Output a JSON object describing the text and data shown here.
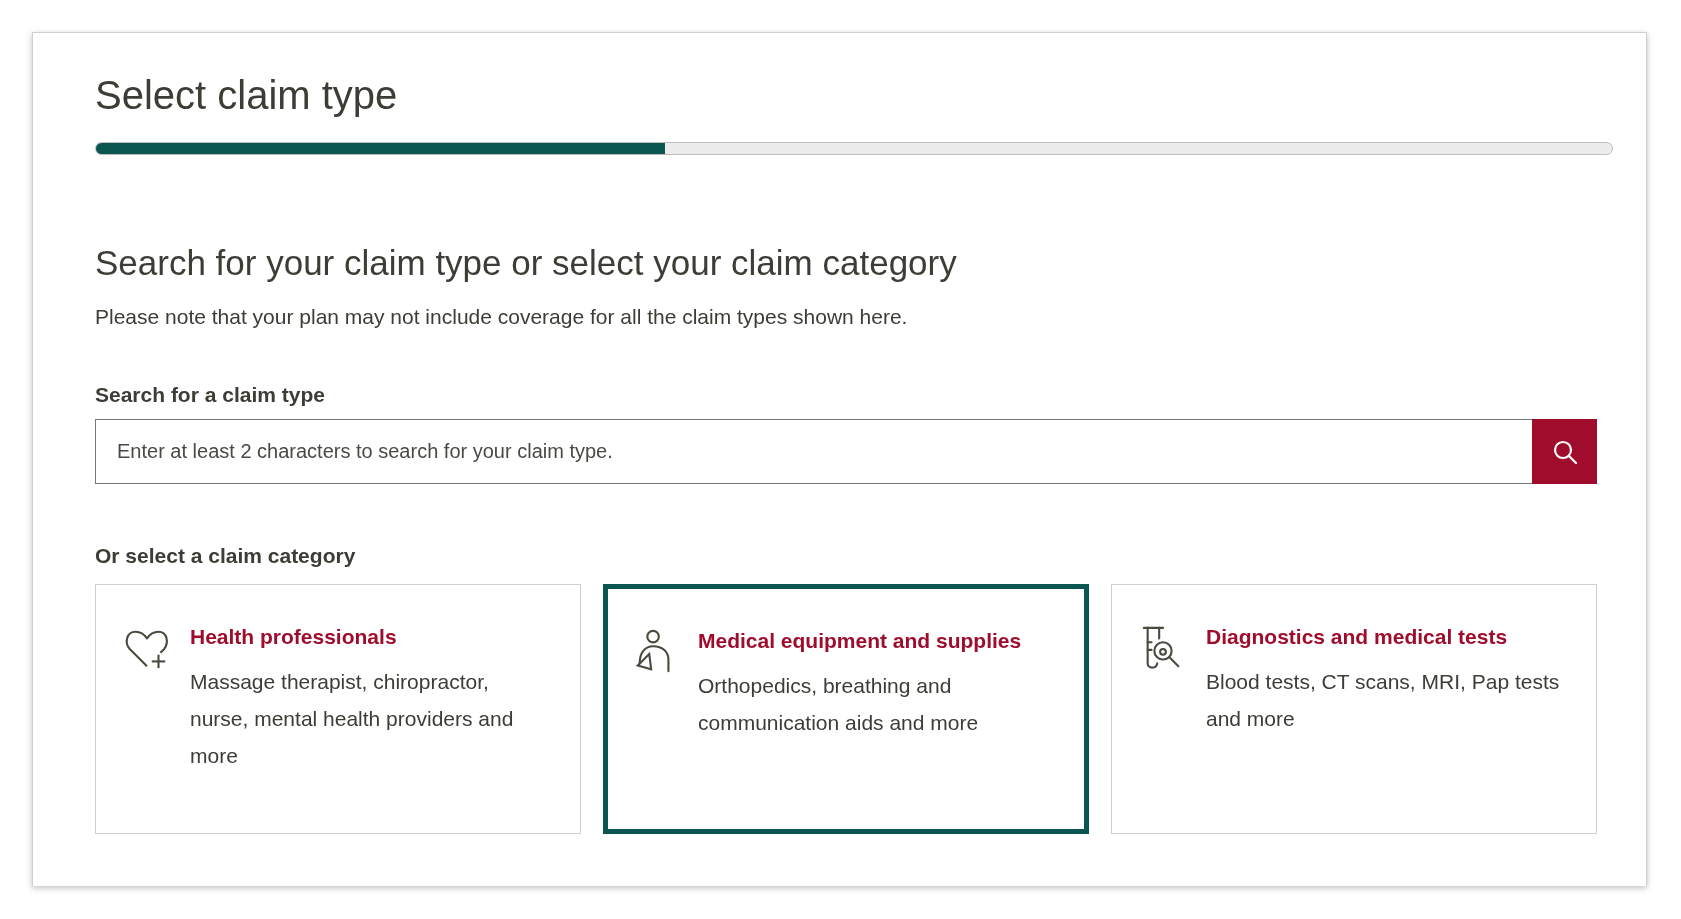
{
  "page_title": "Select claim type",
  "progress": {
    "level": 0.375
  },
  "heading": "Search for your claim type or select your claim category",
  "note": "Please note that your plan may not include coverage for all the claim types shown here.",
  "search": {
    "label": "Search for a claim type",
    "placeholder": "Enter at least 2 characters to search for your claim type."
  },
  "categories_label": "Or select a claim category",
  "categories": [
    {
      "kind": "heart",
      "title": "Health professionals",
      "description": "Massage therapist, chiropractor, nurse, mental health providers and more",
      "selected": false
    },
    {
      "kind": "person",
      "title": "Medical equipment and supplies",
      "description": "Orthopedics, breathing and communication aids and more",
      "selected": true
    },
    {
      "kind": "test-tube",
      "title": "Diagnostics and medical tests",
      "description": "Blood tests, CT scans, MRI, Pap tests and more",
      "selected": false
    }
  ]
}
